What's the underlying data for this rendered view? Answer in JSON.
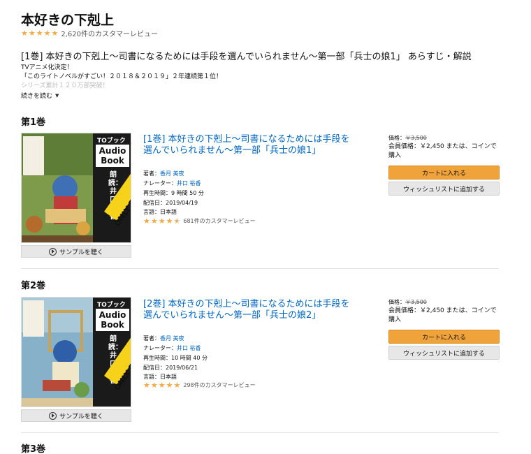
{
  "series": {
    "title": "本好きの下剋上",
    "rating_count": "2,620件のカスタマーレビュー",
    "rating_stars": 5
  },
  "summary": {
    "title": "[1巻] 本好きの下剋上～司書になるためには手段を選んでいられません～第一部「兵士の娘1」 あらすじ・解説",
    "lines": [
      "TVアニメ化決定！",
      "「このライトノベルがすごい！２０１８＆２０１９」２年連続第１位！",
      "シリーズ累計１２０万部突破！"
    ],
    "read_more": "続きを読む"
  },
  "volumes": [
    {
      "heading": "第1巻",
      "title": "[1巻] 本好きの下剋上～司書になるためには手段を選んでいられません～第一部「兵士の娘1」",
      "author_label": "著者：",
      "author": "香月 美夜",
      "narrator_label": "ナレーター：",
      "narrator": "井口 裕香",
      "duration": "再生時間：9 時間 50 分",
      "release": "配信日：2019/04/19",
      "language": "言語：日本語",
      "rating": 4.5,
      "rating_count": "681件のカスタマーレビュー",
      "price_label": "価格：",
      "price": "￥3,500",
      "member_price": "会員価格：￥2,450 または、コインで購入",
      "cart": "カートに入れる",
      "wishlist": "ウィッシュリストに追加する",
      "sample": "サンプルを聴く",
      "cover": {
        "brand": "TOブックス",
        "audio": "Audio Book",
        "narration": "朗読：井口裕香",
        "only": "ONLY FROM audible",
        "vol": "I",
        "book_title": "本好きの下剋上"
      }
    },
    {
      "heading": "第2巻",
      "title": "[2巻] 本好きの下剋上～司書になるためには手段を選んでいられません～第一部「兵士の娘2」",
      "author_label": "著者：",
      "author": "香月 美夜",
      "narrator_label": "ナレーター：",
      "narrator": "井口 裕香",
      "duration": "再生時間：10 時間 40 分",
      "release": "配信日：2019/06/21",
      "language": "言語：日本語",
      "rating": 5,
      "rating_count": "298件のカスタマーレビュー",
      "price_label": "価格：",
      "price": "￥3,500",
      "member_price": "会員価格：￥2,450 または、コインで購入",
      "cart": "カートに入れる",
      "wishlist": "ウィッシュリストに追加する",
      "sample": "サンプルを聴く",
      "cover": {
        "brand": "TOブックス",
        "audio": "Audio Book",
        "narration": "朗読：井口裕香",
        "only": "ONLY FROM audible",
        "vol": "II",
        "book_title": "本好きの下剋上"
      }
    },
    {
      "heading": "第3巻"
    }
  ],
  "colors": {
    "link": "#0066c0",
    "star": "#f3a847",
    "cart_button": "#f0a33a",
    "wish_button": "#e7e7e7"
  },
  "icons": {
    "star": "star-icon",
    "play": "play-circle-icon",
    "caret": "caret-down-icon"
  }
}
